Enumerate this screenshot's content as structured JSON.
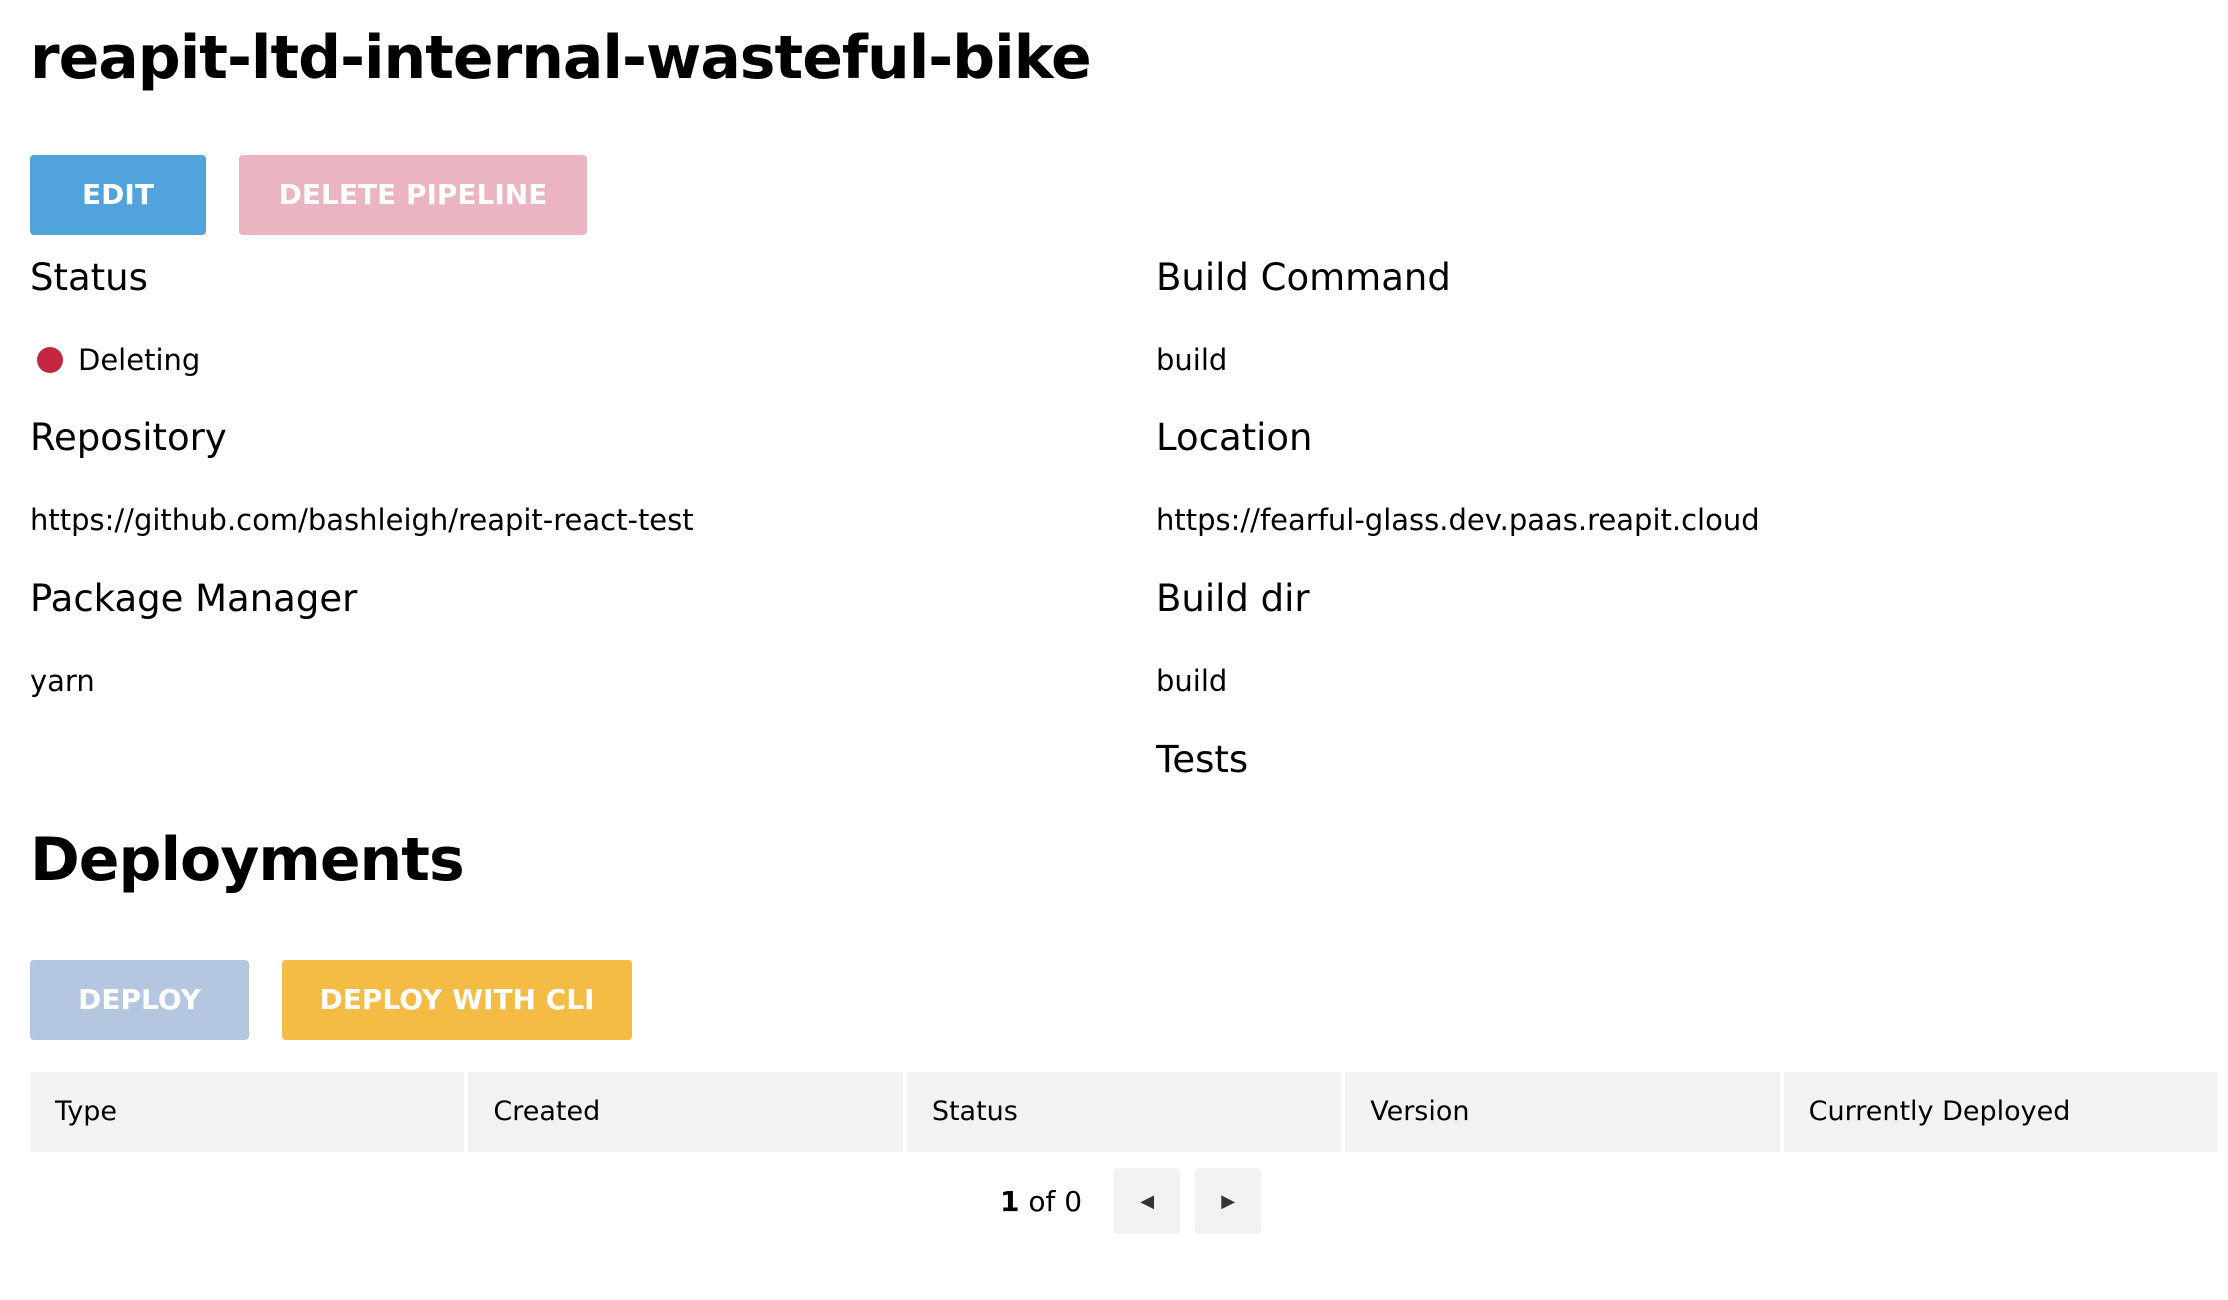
{
  "header": {
    "title": "reapit-ltd-internal-wasteful-bike"
  },
  "actions": {
    "edit_label": "Edit",
    "delete_label": "Delete Pipeline"
  },
  "details": {
    "status_label": "Status",
    "status_value": "Deleting",
    "status_color": "#c4253f",
    "repository_label": "Repository",
    "repository_value": "https://github.com/bashleigh/reapit-react-test",
    "package_manager_label": "Package Manager",
    "package_manager_value": "yarn",
    "build_command_label": "Build Command",
    "build_command_value": "build",
    "location_label": "Location",
    "location_value": "https://fearful-glass.dev.paas.reapit.cloud",
    "build_dir_label": "Build dir",
    "build_dir_value": "build",
    "tests_label": "Tests"
  },
  "deployments": {
    "title": "Deployments",
    "deploy_label": "Deploy",
    "deploy_cli_label": "Deploy with CLI",
    "columns": [
      "Type",
      "Created",
      "Status",
      "Version",
      "Currently Deployed"
    ],
    "pagination": {
      "current": "1",
      "of_label": "of",
      "total": "0",
      "prev_icon": "caret-left-icon",
      "next_icon": "caret-right-icon"
    }
  },
  "colors": {
    "edit_button": "#51a3dc",
    "delete_button": "#eab5c0",
    "deploy_button": "#b5c7e0",
    "deploy_cli_button": "#f4bb45"
  }
}
